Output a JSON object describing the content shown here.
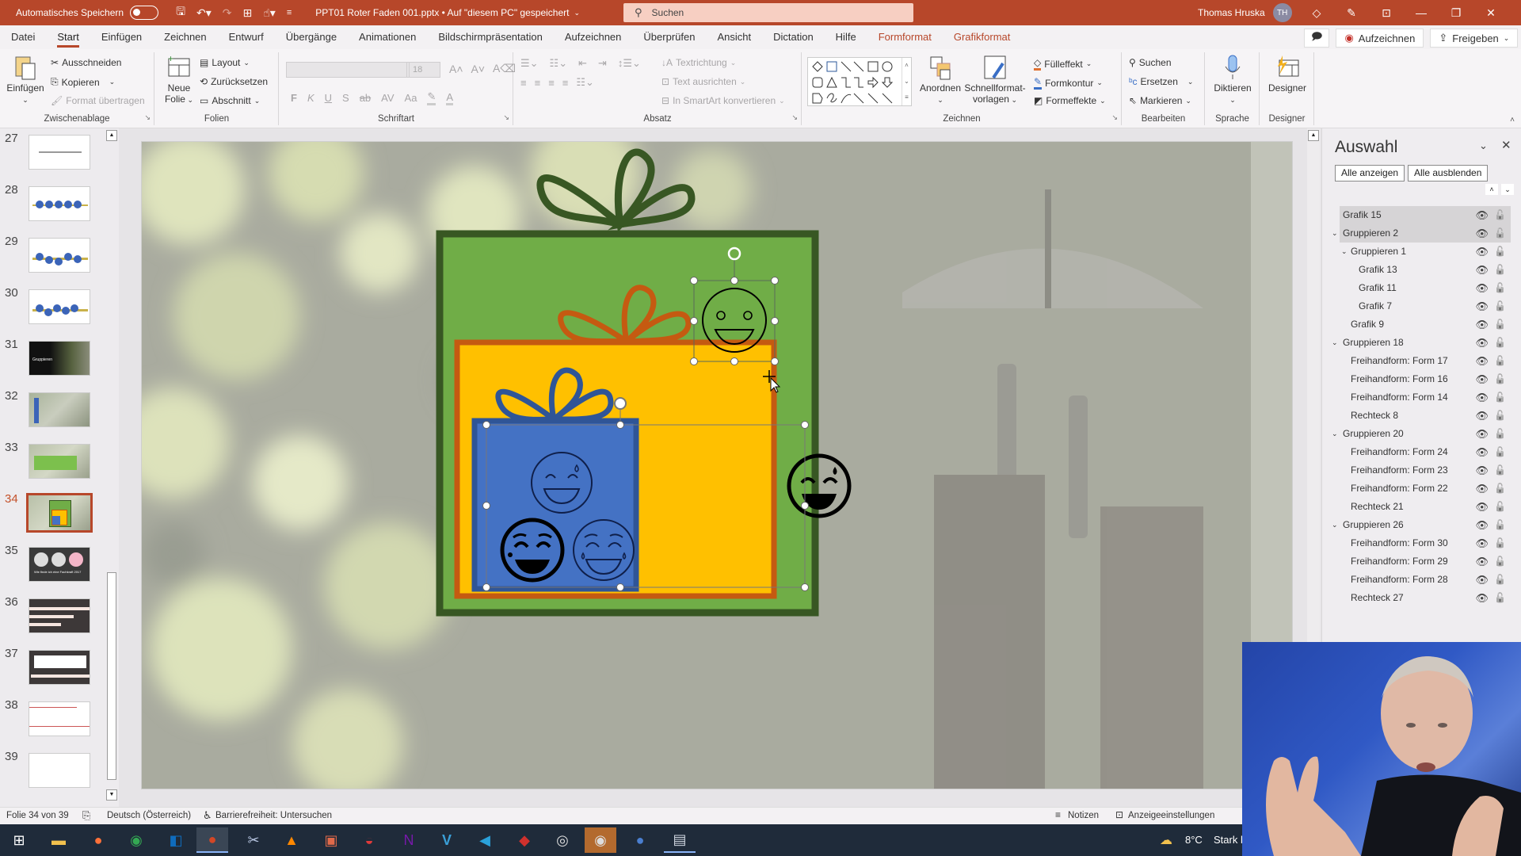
{
  "titlebar": {
    "autosave_label": "Automatisches Speichern",
    "document_title": "PPT01 Roter Faden 001.pptx • Auf \"diesem PC\" gespeichert",
    "search_placeholder": "Suchen",
    "user_name": "Thomas Hruska",
    "user_initials": "TH",
    "colors": {
      "accent": "#b7472a"
    }
  },
  "tabs": [
    {
      "label": "Datei"
    },
    {
      "label": "Start",
      "active": true
    },
    {
      "label": "Einfügen"
    },
    {
      "label": "Zeichnen"
    },
    {
      "label": "Entwurf"
    },
    {
      "label": "Übergänge"
    },
    {
      "label": "Animationen"
    },
    {
      "label": "Bildschirmpräsentation"
    },
    {
      "label": "Aufzeichnen"
    },
    {
      "label": "Überprüfen"
    },
    {
      "label": "Ansicht"
    },
    {
      "label": "Dictation"
    },
    {
      "label": "Hilfe"
    },
    {
      "label": "Formformat",
      "contextual": true
    },
    {
      "label": "Grafikformat",
      "contextual": true
    }
  ],
  "tab_actions": {
    "record": "Aufzeichnen",
    "share": "Freigeben"
  },
  "ribbon": {
    "clipboard": {
      "label": "Zwischenablage",
      "paste": "Einfügen",
      "cut": "Ausschneiden",
      "copy": "Kopieren",
      "format_painter": "Format übertragen"
    },
    "slides": {
      "label": "Folien",
      "new_slide_1": "Neue",
      "new_slide_2": "Folie",
      "layout": "Layout",
      "reset": "Zurücksetzen",
      "section": "Abschnitt"
    },
    "font": {
      "label": "Schriftart",
      "font_name": "",
      "font_size": "18",
      "bold": "F",
      "italic": "K",
      "underline": "U",
      "shadow": "S",
      "strike": "ab",
      "spacing": "AV",
      "case": "Aa"
    },
    "paragraph": {
      "label": "Absatz",
      "text_direction": "Textrichtung",
      "align_text": "Text ausrichten",
      "smartart": "In SmartArt konvertieren"
    },
    "drawing": {
      "label": "Zeichnen",
      "arrange": "Anordnen",
      "quick_styles_1": "Schnellformat-",
      "quick_styles_2": "vorlagen",
      "fill": "Fülleffekt",
      "outline": "Formkontur",
      "effects": "Formeffekte"
    },
    "editing": {
      "label": "Bearbeiten",
      "find": "Suchen",
      "replace": "Ersetzen",
      "select": "Markieren"
    },
    "voice": {
      "label": "Sprache",
      "dictate": "Diktieren"
    },
    "designer": {
      "label": "Designer",
      "designer": "Designer"
    }
  },
  "thumbnails": [
    {
      "num": "27"
    },
    {
      "num": "28"
    },
    {
      "num": "29"
    },
    {
      "num": "30"
    },
    {
      "num": "31",
      "caption": "Gruppieren"
    },
    {
      "num": "32"
    },
    {
      "num": "33"
    },
    {
      "num": "34",
      "selected": true
    },
    {
      "num": "35",
      "caption": "Wie finde ich eine Fachkraft 2017"
    },
    {
      "num": "36"
    },
    {
      "num": "37"
    },
    {
      "num": "38"
    },
    {
      "num": "39"
    }
  ],
  "slide": {
    "colors": {
      "outer_fill": "#70ad47",
      "outer_border": "#385723",
      "middle_fill": "#ffc000",
      "middle_border": "#c55a11",
      "inner_fill": "#4472c4",
      "inner_border": "#2f5597"
    }
  },
  "selection_pane": {
    "title": "Auswahl",
    "show_all": "Alle anzeigen",
    "hide_all": "Alle ausblenden",
    "items": [
      {
        "label": "Grafik 15",
        "level": 0,
        "selected": true
      },
      {
        "label": "Gruppieren 2",
        "level": 0,
        "group": true,
        "selected": true
      },
      {
        "label": "Gruppieren 1",
        "level": 1,
        "group": true
      },
      {
        "label": "Grafik 13",
        "level": 2
      },
      {
        "label": "Grafik 11",
        "level": 2
      },
      {
        "label": "Grafik 7",
        "level": 2
      },
      {
        "label": "Grafik 9",
        "level": 1
      },
      {
        "label": "Gruppieren 18",
        "level": 0,
        "group": true
      },
      {
        "label": "Freihandform: Form 17",
        "level": 1
      },
      {
        "label": "Freihandform: Form 16",
        "level": 1
      },
      {
        "label": "Freihandform: Form 14",
        "level": 1
      },
      {
        "label": "Rechteck 8",
        "level": 1
      },
      {
        "label": "Gruppieren 20",
        "level": 0,
        "group": true
      },
      {
        "label": "Freihandform: Form 24",
        "level": 1
      },
      {
        "label": "Freihandform: Form 23",
        "level": 1
      },
      {
        "label": "Freihandform: Form 22",
        "level": 1
      },
      {
        "label": "Rechteck 21",
        "level": 1
      },
      {
        "label": "Gruppieren 26",
        "level": 0,
        "group": true
      },
      {
        "label": "Freihandform: Form 30",
        "level": 1
      },
      {
        "label": "Freihandform: Form 29",
        "level": 1
      },
      {
        "label": "Freihandform: Form 28",
        "level": 1
      },
      {
        "label": "Rechteck 27",
        "level": 1
      }
    ]
  },
  "status": {
    "slide_info": "Folie 34 von 39",
    "language": "Deutsch (Österreich)",
    "accessibility": "Barrierefreiheit: Untersuchen",
    "notes": "Notizen",
    "display_settings": "Anzeigeeinstellungen"
  },
  "taskbar": {
    "weather_temp": "8°C",
    "weather_text": "Stark b",
    "apps": [
      "windows-start",
      "file-explorer",
      "firefox",
      "chrome",
      "outlook",
      "powerpoint",
      "snip",
      "vlc",
      "office",
      "lips-app",
      "onenote",
      "visio",
      "telegram",
      "acrobat",
      "obs",
      "recorder",
      "blue-app",
      "monitor-app"
    ]
  }
}
